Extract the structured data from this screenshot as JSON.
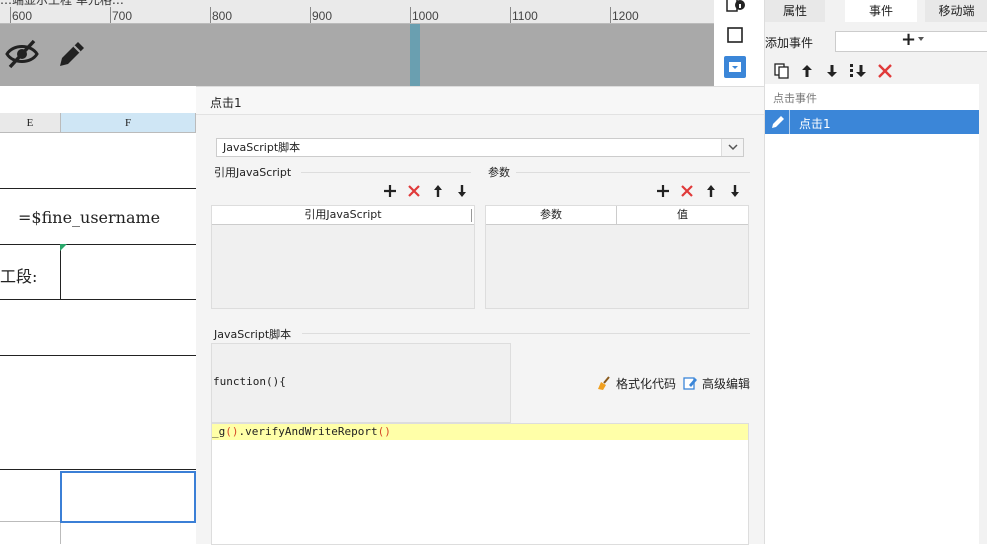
{
  "ruler": {
    "ticks": [
      "600",
      "700",
      "800",
      "900",
      "1000",
      "1100",
      "1200"
    ],
    "cut_title": "…端显示工程 单元格…"
  },
  "sheet": {
    "col_e": "E",
    "col_f": "F",
    "formula_cell": "=$fine_username",
    "partial_label": "工段:"
  },
  "right_panel": {
    "tabs": [
      "属性",
      "事件",
      "移动端"
    ],
    "add_event_label": "添加事件",
    "add_event_symbol": "+",
    "event_category": "点击事件",
    "event_item": "点击1"
  },
  "dialog": {
    "title": "点击1",
    "script_type": "JavaScript脚本",
    "ref_js_label": "引用JavaScript",
    "ref_js_column": "引用JavaScript",
    "params_label": "参数",
    "params_col_name": "参数",
    "params_col_value": "值",
    "script_label": "JavaScript脚本",
    "function_header": "function(){",
    "code_prefix": "_g",
    "code_p1": "(",
    "code_p2": ")",
    "code_method": ".verifyAndWriteReport",
    "code_p3": "(",
    "code_p4": ")",
    "format_code": "格式化代码",
    "advanced_edit": "高级编辑"
  },
  "colors": {
    "accent": "#3b86d8",
    "delete_red": "#e03a3a",
    "code_highlight": "#ffffa8"
  }
}
